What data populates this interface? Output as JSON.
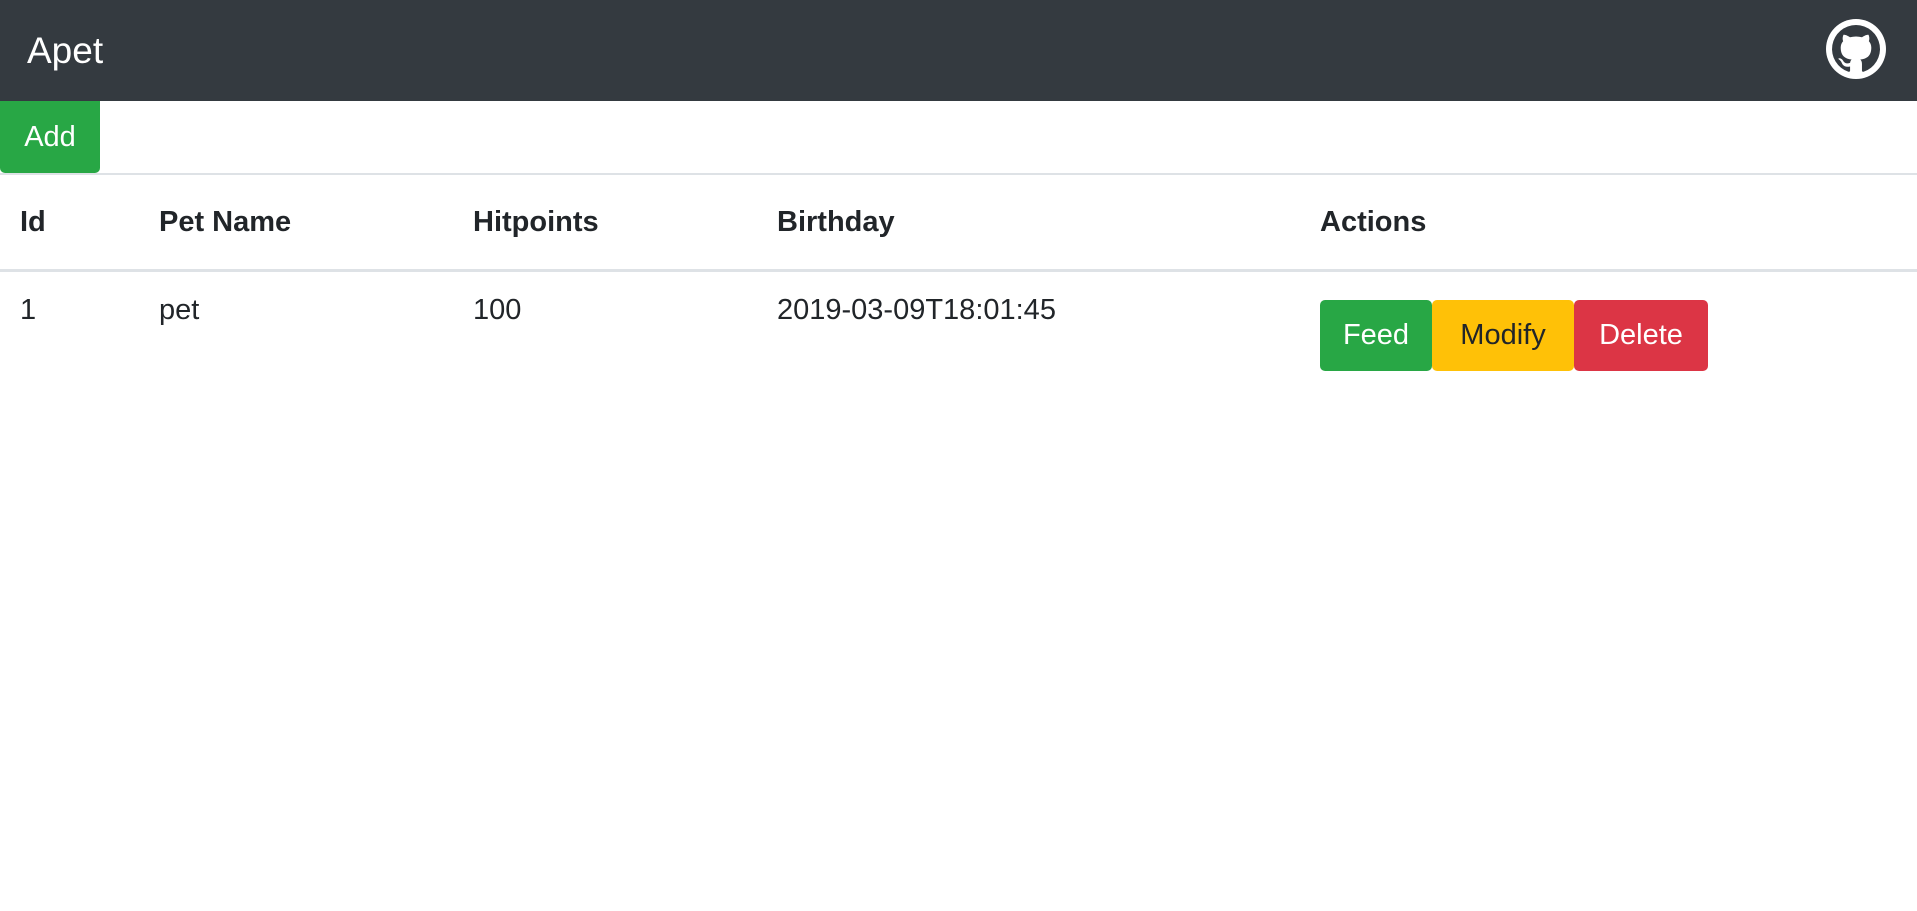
{
  "navbar": {
    "brand": "Apet",
    "github_icon": "github-icon"
  },
  "toolbar": {
    "add_label": "Add"
  },
  "table": {
    "headers": [
      "Id",
      "Pet Name",
      "Hitpoints",
      "Birthday",
      "Actions"
    ],
    "rows": [
      {
        "id": "1",
        "name": "pet",
        "hitpoints": "100",
        "birthday": "2019-03-09T18:01:45",
        "actions": {
          "feed": "Feed",
          "modify": "Modify",
          "delete": "Delete"
        }
      }
    ]
  },
  "colors": {
    "navbar": "#343a40",
    "success": "#28a745",
    "warning": "#ffc107",
    "danger": "#dc3545"
  }
}
